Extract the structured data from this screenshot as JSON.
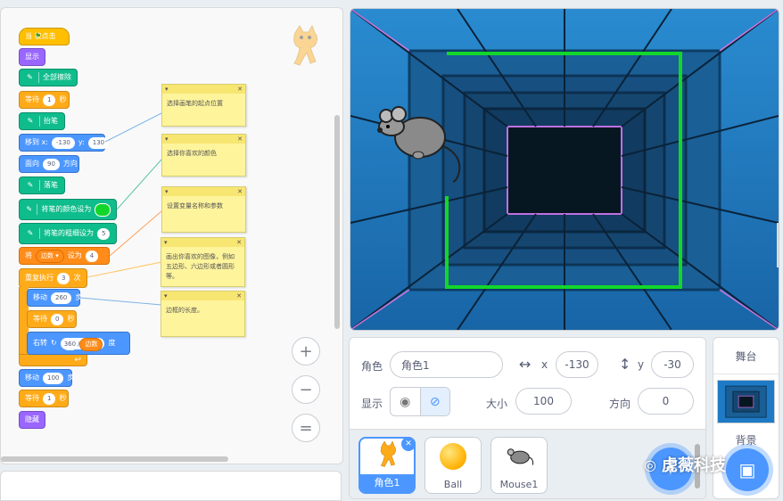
{
  "code": {
    "hat": "当 被点击",
    "show": "显示",
    "erase_all": "全部擦除",
    "wait_label": "等待",
    "wait_unit": "秒",
    "wait1": "1",
    "pen_up": "抬笔",
    "goto_label": "移到 x:",
    "goto_x": "-130",
    "goto_y_label": "y:",
    "goto_y": "130",
    "point_label": "面向",
    "point_val": "90",
    "point_unit": "方向",
    "pen_down": "落笔",
    "set_color": "将笔的颜色设为",
    "set_size": "将笔的粗细设为",
    "set_size_val": "5",
    "set_var_label": "将",
    "set_var_name": "边数 ▾",
    "set_var_to": "设为",
    "set_var_val": "4",
    "repeat_label": "重复执行",
    "repeat_val": "3",
    "repeat_unit": "次",
    "move_label": "移动",
    "move_val": "260",
    "move_unit": "步",
    "wait0": "0",
    "turn_label": "右转",
    "turn_num": "360",
    "turn_div": "/",
    "turn_var": "边数",
    "turn_unit": "度",
    "move2_val": "100",
    "wait2": "1",
    "hide": "隐藏",
    "pen_color": "#13d62a"
  },
  "notes": [
    "选择画笔的起点位置",
    "选择你喜欢的颜色",
    "设置变量名称和参数",
    "画出你喜欢的图像，例如五边形、六边形或者圆形等。",
    "边框的长度。"
  ],
  "zoom": {
    "in": "+",
    "out": "−",
    "reset": "="
  },
  "sprite_info": {
    "sprite_label": "角色",
    "sprite_name": "角色1",
    "x_label": "x",
    "x": "-130",
    "y_label": "y",
    "y": "-30",
    "show_label": "显示",
    "size_label": "大小",
    "size": "100",
    "direction_label": "方向",
    "direction": "0"
  },
  "sprites": [
    {
      "name": "角色1",
      "selected": true
    },
    {
      "name": "Ball",
      "selected": false
    },
    {
      "name": "Mouse1",
      "selected": false
    }
  ],
  "stage_panel": {
    "title": "舞台",
    "backdrop_label": "背景"
  },
  "watermark": "虎薇科技",
  "colors": {
    "accent": "#4c97ff",
    "pen": "#13d62a",
    "stage_bg": "#1e7ac4"
  }
}
